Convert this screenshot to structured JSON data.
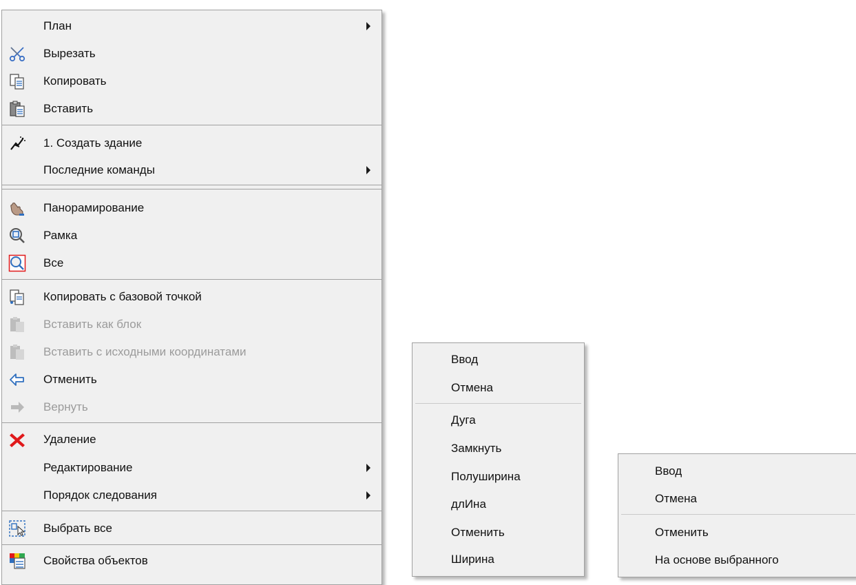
{
  "main_menu": {
    "items": [
      {
        "label": "План",
        "submenu": true
      },
      {
        "label": "Вырезать",
        "icon": "scissors-icon"
      },
      {
        "label": "Копировать",
        "icon": "copy-icon"
      },
      {
        "label": "Вставить",
        "icon": "paste-icon"
      },
      {
        "label": "1. Создать здание",
        "icon": "create-building-icon"
      },
      {
        "label": "Последние команды",
        "submenu": true
      },
      {
        "label": "Панорамирование",
        "icon": "pan-hand-icon"
      },
      {
        "label": "Рамка",
        "icon": "zoom-window-icon"
      },
      {
        "label": "Все",
        "icon": "zoom-all-icon"
      },
      {
        "label": "Копировать с базовой точкой",
        "icon": "copy-base-point-icon"
      },
      {
        "label": "Вставить как блок",
        "icon": "paste-block-icon",
        "disabled": true
      },
      {
        "label": "Вставить с исходными координатами",
        "icon": "paste-original-coords-icon",
        "disabled": true
      },
      {
        "label": "Отменить",
        "icon": "undo-icon"
      },
      {
        "label": "Вернуть",
        "icon": "redo-icon",
        "disabled": true
      },
      {
        "label": "Удаление",
        "icon": "delete-icon"
      },
      {
        "label": "Редактирование",
        "submenu": true
      },
      {
        "label": "Порядок следования",
        "submenu": true
      },
      {
        "label": "Выбрать все",
        "icon": "select-all-icon"
      },
      {
        "label": "Свойства объектов",
        "icon": "object-properties-icon"
      }
    ]
  },
  "polyline_menu": {
    "items": [
      "Ввод",
      "Отмена",
      "Дуга",
      "Замкнуть",
      "Полуширина",
      "длИна",
      "Отменить",
      "Ширина"
    ]
  },
  "select_menu": {
    "items": [
      "Ввод",
      "Отмена",
      "Отменить",
      "На основе выбранного"
    ]
  },
  "colors": {
    "menu_background": "#f0f0f0",
    "separator": "#a0a0a0",
    "disabled_text": "#9b9b9b",
    "delete_red": "#e0191b",
    "icon_blue": "#2f6fbf"
  }
}
